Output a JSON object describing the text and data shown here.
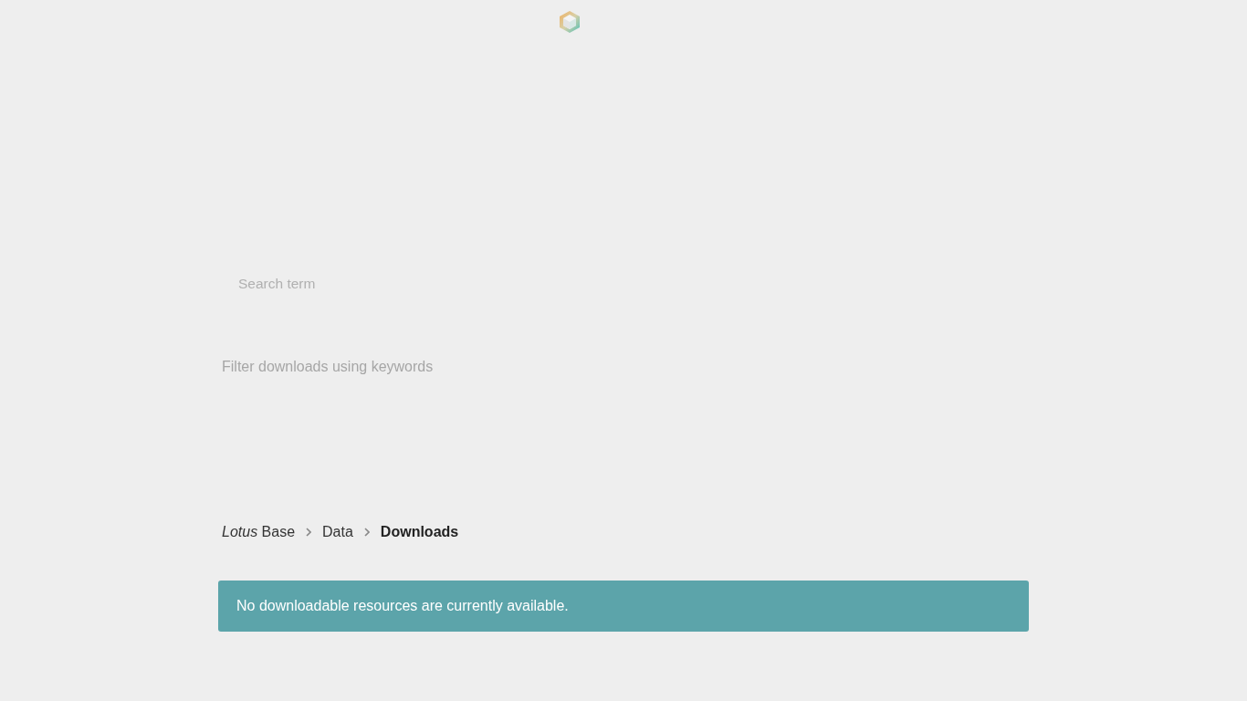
{
  "search": {
    "placeholder": "Search term",
    "hint": "Filter downloads using keywords"
  },
  "breadcrumb": [
    {
      "label": "*Lotus* Base",
      "current": false
    },
    {
      "label": "Data",
      "current": false
    },
    {
      "label": "Downloads",
      "current": true
    }
  ],
  "alert": {
    "text": "No downloadable resources are currently available."
  }
}
